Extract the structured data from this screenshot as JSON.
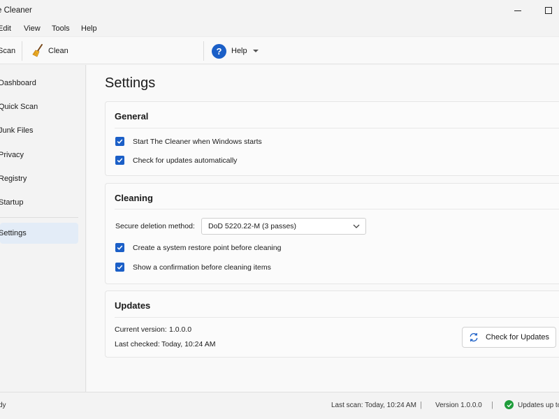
{
  "window": {
    "title": "e Cleaner"
  },
  "menu": [
    "Edit",
    "View",
    "Tools",
    "Help"
  ],
  "toolbar": {
    "scan_label": "Scan",
    "clean_label": "Clean",
    "help_label": "Help"
  },
  "sidebar": {
    "items": [
      {
        "label": "Dashboard"
      },
      {
        "label": "Quick Scan"
      },
      {
        "label": "Junk Files"
      },
      {
        "label": "Privacy"
      },
      {
        "label": "Registry"
      },
      {
        "label": "Startup"
      },
      {
        "label": "Settings"
      }
    ]
  },
  "main": {
    "title": "Settings",
    "general": {
      "title": "General",
      "start_label": "Start The Cleaner when Windows starts",
      "updates_label": "Check for updates automatically"
    },
    "cleaning": {
      "title": "Cleaning",
      "method_label": "Secure deletion method:",
      "method_value": "DoD 5220.22-M (3 passes)",
      "restore_label": "Create a system restore point before cleaning",
      "confirm_label": "Show a confirmation before cleaning items"
    },
    "updates": {
      "title": "Updates",
      "version_label": "Current version:",
      "version_value": "1.0.0.0",
      "checked_label": "Last checked:",
      "checked_value": "Today, 10:24 AM",
      "check_button": "Check for Updates"
    }
  },
  "status": {
    "left": "dy",
    "last_scan": "Last scan: Today, 10:24 AM",
    "sep": "|",
    "version": "Version 1.0.0.0",
    "updates": "Updates up to"
  },
  "colors": {
    "accent": "#1b5fc7",
    "ok": "#1f9d3b"
  }
}
